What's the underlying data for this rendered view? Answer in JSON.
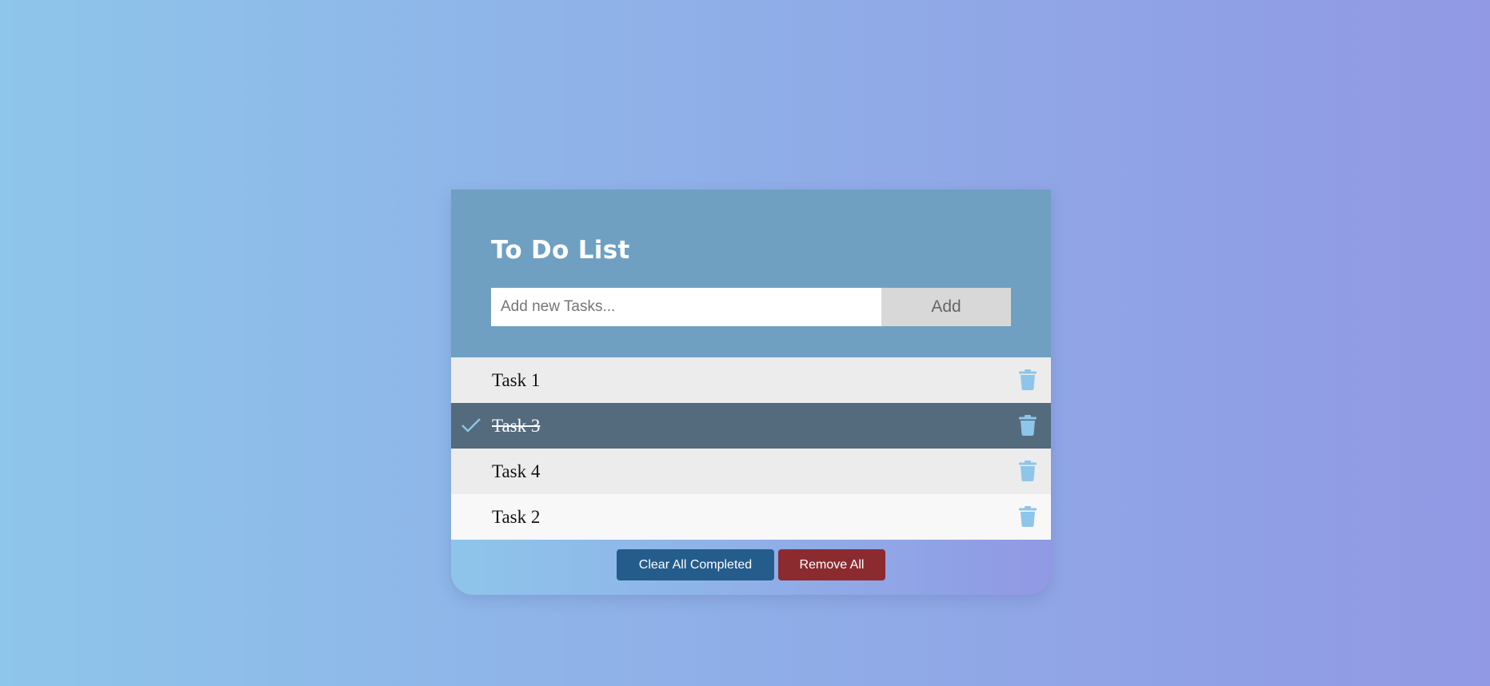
{
  "app": {
    "title": "To Do List"
  },
  "input": {
    "placeholder": "Add new Tasks...",
    "value": "",
    "add_label": "Add"
  },
  "tasks": [
    {
      "label": "Task 1",
      "completed": false,
      "check_icon": "",
      "delete_icon": "trash-icon"
    },
    {
      "label": "Task 3",
      "completed": true,
      "check_icon": "checkmark-icon",
      "delete_icon": "trash-icon"
    },
    {
      "label": "Task 4",
      "completed": false,
      "check_icon": "",
      "delete_icon": "trash-icon"
    },
    {
      "label": "Task 2",
      "completed": false,
      "check_icon": "",
      "delete_icon": "trash-icon"
    }
  ],
  "footer": {
    "clear_completed_label": "Clear All Completed",
    "remove_all_label": "Remove All"
  },
  "colors": {
    "header_bg": "#6fa0c2",
    "completed_row_bg": "#546a7d",
    "icon_color": "#8ec5ea",
    "clear_button_bg": "#245c8c",
    "remove_button_bg": "#8b2b30"
  }
}
